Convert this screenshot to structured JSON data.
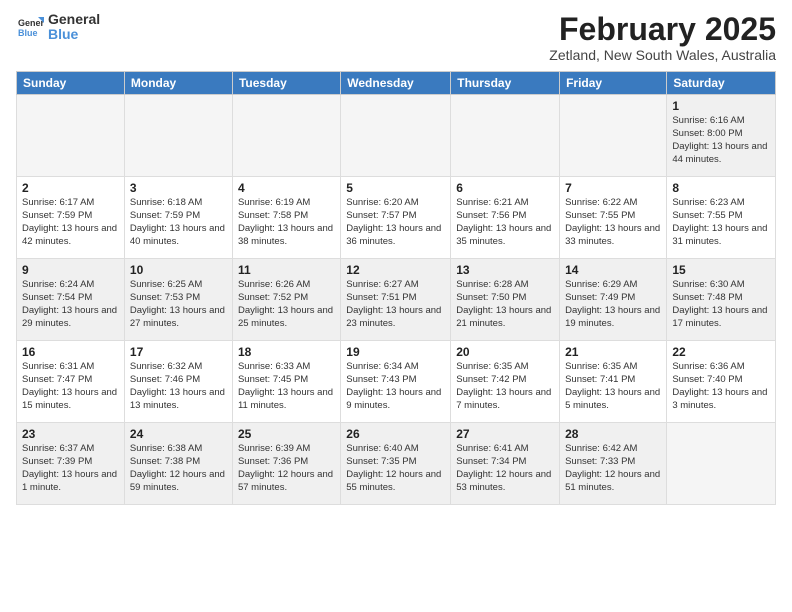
{
  "logo": {
    "general": "General",
    "blue": "Blue"
  },
  "title": "February 2025",
  "location": "Zetland, New South Wales, Australia",
  "weekdays": [
    "Sunday",
    "Monday",
    "Tuesday",
    "Wednesday",
    "Thursday",
    "Friday",
    "Saturday"
  ],
  "weeks": [
    [
      {
        "day": "",
        "info": ""
      },
      {
        "day": "",
        "info": ""
      },
      {
        "day": "",
        "info": ""
      },
      {
        "day": "",
        "info": ""
      },
      {
        "day": "",
        "info": ""
      },
      {
        "day": "",
        "info": ""
      },
      {
        "day": "1",
        "info": "Sunrise: 6:16 AM\nSunset: 8:00 PM\nDaylight: 13 hours\nand 44 minutes."
      }
    ],
    [
      {
        "day": "2",
        "info": "Sunrise: 6:17 AM\nSunset: 7:59 PM\nDaylight: 13 hours\nand 42 minutes."
      },
      {
        "day": "3",
        "info": "Sunrise: 6:18 AM\nSunset: 7:59 PM\nDaylight: 13 hours\nand 40 minutes."
      },
      {
        "day": "4",
        "info": "Sunrise: 6:19 AM\nSunset: 7:58 PM\nDaylight: 13 hours\nand 38 minutes."
      },
      {
        "day": "5",
        "info": "Sunrise: 6:20 AM\nSunset: 7:57 PM\nDaylight: 13 hours\nand 36 minutes."
      },
      {
        "day": "6",
        "info": "Sunrise: 6:21 AM\nSunset: 7:56 PM\nDaylight: 13 hours\nand 35 minutes."
      },
      {
        "day": "7",
        "info": "Sunrise: 6:22 AM\nSunset: 7:55 PM\nDaylight: 13 hours\nand 33 minutes."
      },
      {
        "day": "8",
        "info": "Sunrise: 6:23 AM\nSunset: 7:55 PM\nDaylight: 13 hours\nand 31 minutes."
      }
    ],
    [
      {
        "day": "9",
        "info": "Sunrise: 6:24 AM\nSunset: 7:54 PM\nDaylight: 13 hours\nand 29 minutes."
      },
      {
        "day": "10",
        "info": "Sunrise: 6:25 AM\nSunset: 7:53 PM\nDaylight: 13 hours\nand 27 minutes."
      },
      {
        "day": "11",
        "info": "Sunrise: 6:26 AM\nSunset: 7:52 PM\nDaylight: 13 hours\nand 25 minutes."
      },
      {
        "day": "12",
        "info": "Sunrise: 6:27 AM\nSunset: 7:51 PM\nDaylight: 13 hours\nand 23 minutes."
      },
      {
        "day": "13",
        "info": "Sunrise: 6:28 AM\nSunset: 7:50 PM\nDaylight: 13 hours\nand 21 minutes."
      },
      {
        "day": "14",
        "info": "Sunrise: 6:29 AM\nSunset: 7:49 PM\nDaylight: 13 hours\nand 19 minutes."
      },
      {
        "day": "15",
        "info": "Sunrise: 6:30 AM\nSunset: 7:48 PM\nDaylight: 13 hours\nand 17 minutes."
      }
    ],
    [
      {
        "day": "16",
        "info": "Sunrise: 6:31 AM\nSunset: 7:47 PM\nDaylight: 13 hours\nand 15 minutes."
      },
      {
        "day": "17",
        "info": "Sunrise: 6:32 AM\nSunset: 7:46 PM\nDaylight: 13 hours\nand 13 minutes."
      },
      {
        "day": "18",
        "info": "Sunrise: 6:33 AM\nSunset: 7:45 PM\nDaylight: 13 hours\nand 11 minutes."
      },
      {
        "day": "19",
        "info": "Sunrise: 6:34 AM\nSunset: 7:43 PM\nDaylight: 13 hours\nand 9 minutes."
      },
      {
        "day": "20",
        "info": "Sunrise: 6:35 AM\nSunset: 7:42 PM\nDaylight: 13 hours\nand 7 minutes."
      },
      {
        "day": "21",
        "info": "Sunrise: 6:35 AM\nSunset: 7:41 PM\nDaylight: 13 hours\nand 5 minutes."
      },
      {
        "day": "22",
        "info": "Sunrise: 6:36 AM\nSunset: 7:40 PM\nDaylight: 13 hours\nand 3 minutes."
      }
    ],
    [
      {
        "day": "23",
        "info": "Sunrise: 6:37 AM\nSunset: 7:39 PM\nDaylight: 13 hours\nand 1 minute."
      },
      {
        "day": "24",
        "info": "Sunrise: 6:38 AM\nSunset: 7:38 PM\nDaylight: 12 hours\nand 59 minutes."
      },
      {
        "day": "25",
        "info": "Sunrise: 6:39 AM\nSunset: 7:36 PM\nDaylight: 12 hours\nand 57 minutes."
      },
      {
        "day": "26",
        "info": "Sunrise: 6:40 AM\nSunset: 7:35 PM\nDaylight: 12 hours\nand 55 minutes."
      },
      {
        "day": "27",
        "info": "Sunrise: 6:41 AM\nSunset: 7:34 PM\nDaylight: 12 hours\nand 53 minutes."
      },
      {
        "day": "28",
        "info": "Sunrise: 6:42 AM\nSunset: 7:33 PM\nDaylight: 12 hours\nand 51 minutes."
      },
      {
        "day": "",
        "info": ""
      }
    ]
  ]
}
